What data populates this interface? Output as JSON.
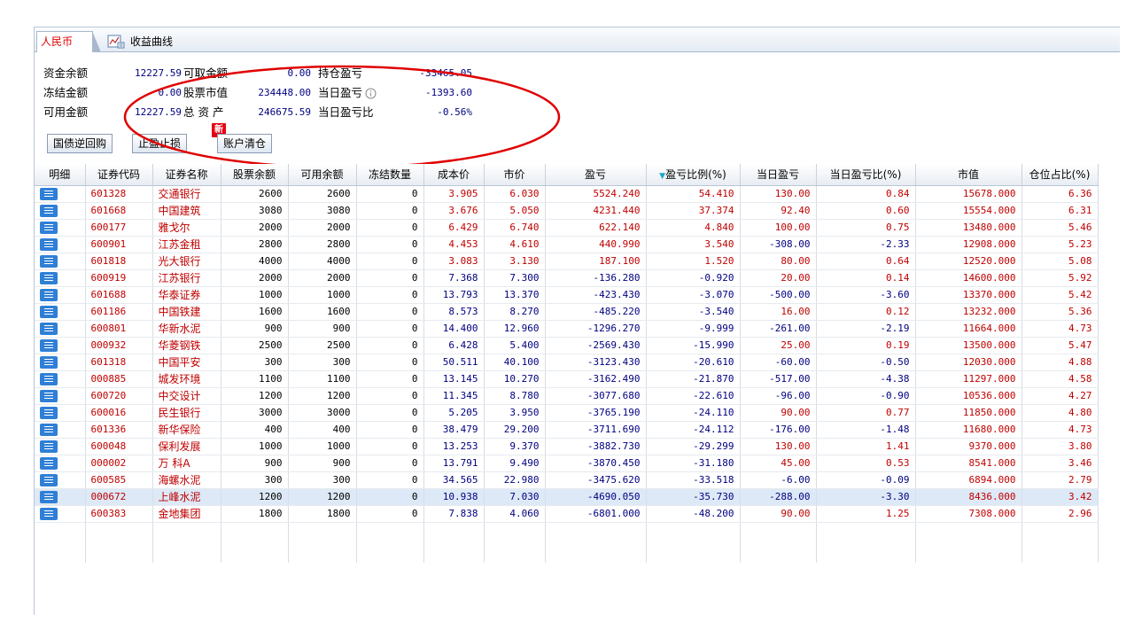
{
  "tabs": {
    "rmb": "人民币",
    "curve": "收益曲线"
  },
  "summary": {
    "cash_balance_label": "资金余额",
    "cash_balance": "12227.59",
    "withdrawable_label": "可取金额",
    "withdrawable": "0.00",
    "position_pl_label": "持仓盈亏",
    "position_pl": "-33465.05",
    "frozen_label": "冻结金额",
    "frozen": "0.00",
    "stock_value_label": "股票市值",
    "stock_value": "234448.00",
    "today_pl_label": "当日盈亏",
    "today_pl": "-1393.60",
    "available_label": "可用金额",
    "available": "12227.59",
    "total_assets_label": "总 资 产",
    "total_assets": "246675.59",
    "today_pl_ratio_label": "当日盈亏比",
    "today_pl_ratio": "-0.56%"
  },
  "buttons": {
    "repo": "国债逆回购",
    "stop": "止盈止损",
    "clear": "账户清仓",
    "new_badge": "新"
  },
  "columns": [
    "明细",
    "证券代码",
    "证券名称",
    "股票余额",
    "可用余额",
    "冻结数量",
    "成本价",
    "市价",
    "盈亏",
    "盈亏比例(%)",
    "当日盈亏",
    "当日盈亏比(%)",
    "市值",
    "仓位占比(%)"
  ],
  "rows": [
    [
      "601328",
      "交通银行",
      "2600",
      "2600",
      "0",
      "3.905",
      "6.030",
      "5524.240",
      "54.410",
      "130.00",
      "0.84",
      "15678.000",
      "6.36"
    ],
    [
      "601668",
      "中国建筑",
      "3080",
      "3080",
      "0",
      "3.676",
      "5.050",
      "4231.440",
      "37.374",
      "92.40",
      "0.60",
      "15554.000",
      "6.31"
    ],
    [
      "600177",
      "雅戈尔",
      "2000",
      "2000",
      "0",
      "6.429",
      "6.740",
      "622.140",
      "4.840",
      "100.00",
      "0.75",
      "13480.000",
      "5.46"
    ],
    [
      "600901",
      "江苏金租",
      "2800",
      "2800",
      "0",
      "4.453",
      "4.610",
      "440.990",
      "3.540",
      "-308.00",
      "-2.33",
      "12908.000",
      "5.23"
    ],
    [
      "601818",
      "光大银行",
      "4000",
      "4000",
      "0",
      "3.083",
      "3.130",
      "187.100",
      "1.520",
      "80.00",
      "0.64",
      "12520.000",
      "5.08"
    ],
    [
      "600919",
      "江苏银行",
      "2000",
      "2000",
      "0",
      "7.368",
      "7.300",
      "-136.280",
      "-0.920",
      "20.00",
      "0.14",
      "14600.000",
      "5.92"
    ],
    [
      "601688",
      "华泰证券",
      "1000",
      "1000",
      "0",
      "13.793",
      "13.370",
      "-423.430",
      "-3.070",
      "-500.00",
      "-3.60",
      "13370.000",
      "5.42"
    ],
    [
      "601186",
      "中国铁建",
      "1600",
      "1600",
      "0",
      "8.573",
      "8.270",
      "-485.220",
      "-3.540",
      "16.00",
      "0.12",
      "13232.000",
      "5.36"
    ],
    [
      "600801",
      "华新水泥",
      "900",
      "900",
      "0",
      "14.400",
      "12.960",
      "-1296.270",
      "-9.999",
      "-261.00",
      "-2.19",
      "11664.000",
      "4.73"
    ],
    [
      "000932",
      "华菱钢铁",
      "2500",
      "2500",
      "0",
      "6.428",
      "5.400",
      "-2569.430",
      "-15.990",
      "25.00",
      "0.19",
      "13500.000",
      "5.47"
    ],
    [
      "601318",
      "中国平安",
      "300",
      "300",
      "0",
      "50.511",
      "40.100",
      "-3123.430",
      "-20.610",
      "-60.00",
      "-0.50",
      "12030.000",
      "4.88"
    ],
    [
      "000885",
      "城发环境",
      "1100",
      "1100",
      "0",
      "13.145",
      "10.270",
      "-3162.490",
      "-21.870",
      "-517.00",
      "-4.38",
      "11297.000",
      "4.58"
    ],
    [
      "600720",
      "中交设计",
      "1200",
      "1200",
      "0",
      "11.345",
      "8.780",
      "-3077.680",
      "-22.610",
      "-96.00",
      "-0.90",
      "10536.000",
      "4.27"
    ],
    [
      "600016",
      "民生银行",
      "3000",
      "3000",
      "0",
      "5.205",
      "3.950",
      "-3765.190",
      "-24.110",
      "90.00",
      "0.77",
      "11850.000",
      "4.80"
    ],
    [
      "601336",
      "新华保险",
      "400",
      "400",
      "0",
      "38.479",
      "29.200",
      "-3711.690",
      "-24.112",
      "-176.00",
      "-1.48",
      "11680.000",
      "4.73"
    ],
    [
      "600048",
      "保利发展",
      "1000",
      "1000",
      "0",
      "13.253",
      "9.370",
      "-3882.730",
      "-29.299",
      "130.00",
      "1.41",
      "9370.000",
      "3.80"
    ],
    [
      "000002",
      "万 科A",
      "900",
      "900",
      "0",
      "13.791",
      "9.490",
      "-3870.450",
      "-31.180",
      "45.00",
      "0.53",
      "8541.000",
      "3.46"
    ],
    [
      "600585",
      "海螺水泥",
      "300",
      "300",
      "0",
      "34.565",
      "22.980",
      "-3475.620",
      "-33.518",
      "-6.00",
      "-0.09",
      "6894.000",
      "2.79"
    ],
    [
      "000672",
      "上峰水泥",
      "1200",
      "1200",
      "0",
      "10.938",
      "7.030",
      "-4690.050",
      "-35.730",
      "-288.00",
      "-3.30",
      "8436.000",
      "3.42"
    ],
    [
      "600383",
      "金地集团",
      "1800",
      "1800",
      "0",
      "7.838",
      "4.060",
      "-6801.000",
      "-48.200",
      "90.00",
      "1.25",
      "7308.000",
      "2.96"
    ]
  ],
  "selected_row": 18,
  "sort_column": "盈亏比例(%)",
  "colors": {
    "positive": "#c00000",
    "negative": "#000080",
    "annotation": "#e00000",
    "accent": "#2f7fd6"
  }
}
